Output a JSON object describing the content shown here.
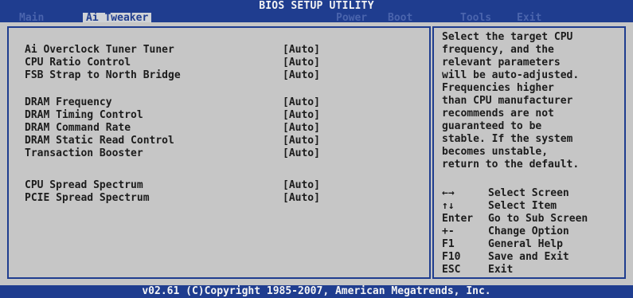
{
  "title": "BIOS SETUP UTILITY",
  "tabs": [
    "Main",
    "Ai Tweaker",
    "Power",
    "Boot",
    "Tools",
    "Exit"
  ],
  "settings": [
    {
      "label": "Ai Overclock Tuner Tuner",
      "value": "[Auto]"
    },
    {
      "label": "CPU Ratio Control",
      "value": "[Auto]"
    },
    {
      "label": "FSB Strap to North Bridge",
      "value": "[Auto]"
    },
    {
      "label": "DRAM Frequency",
      "value": "[Auto]"
    },
    {
      "label": "DRAM Timing Control",
      "value": "[Auto]"
    },
    {
      "label": "DRAM Command Rate",
      "value": "[Auto]"
    },
    {
      "label": "DRAM Static Read Control",
      "value": "[Auto]"
    },
    {
      "label": "Transaction Booster",
      "value": "[Auto]"
    },
    {
      "label": "CPU Spread Spectrum",
      "value": "[Auto]"
    },
    {
      "label": "PCIE Spread Spectrum",
      "value": "[Auto]"
    }
  ],
  "help_text": "Select the target CPU\nfrequency, and the\nrelevant parameters\nwill be auto-adjusted.\nFrequencies higher\nthan CPU manufacturer\nrecommends are not\nguaranteed to be\nstable. If the system\nbecomes unstable,\nreturn to the default.",
  "keys": [
    {
      "key": "←→",
      "desc": "Select Screen",
      "icon": "left-right-arrows-icon"
    },
    {
      "key": "↑↓",
      "desc": "Select Item",
      "icon": "up-down-arrows-icon"
    },
    {
      "key": "Enter",
      "desc": "Go to Sub Screen"
    },
    {
      "key": "+-",
      "desc": "Change Option"
    },
    {
      "key": "F1",
      "desc": "General Help"
    },
    {
      "key": "F10",
      "desc": "Save and Exit"
    },
    {
      "key": "ESC",
      "desc": "Exit"
    }
  ],
  "footer": "v02.61 (C)Copyright 1985-2007, American Megatrends, Inc."
}
